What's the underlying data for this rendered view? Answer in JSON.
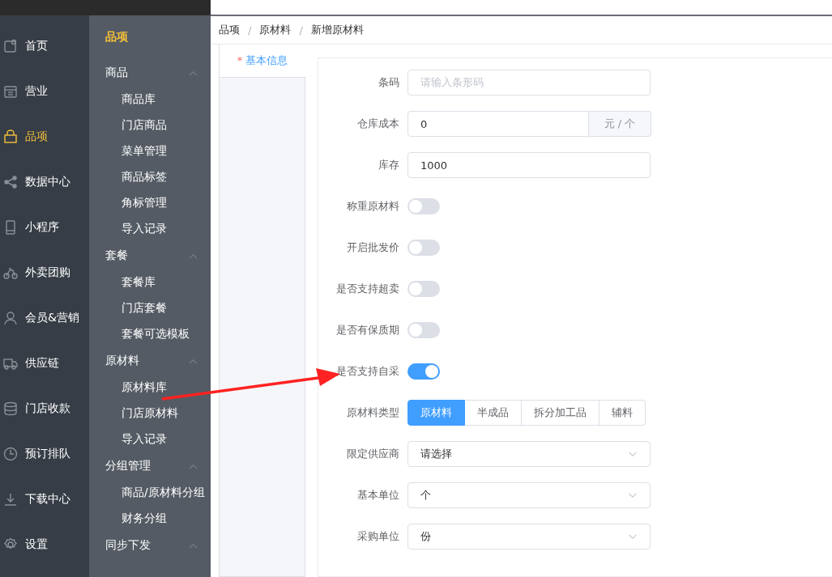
{
  "nav": [
    {
      "label": "首页",
      "selected": false
    },
    {
      "label": "营业",
      "selected": false
    },
    {
      "label": "品项",
      "selected": true
    },
    {
      "label": "数据中心",
      "selected": false
    },
    {
      "label": "小程序",
      "selected": false
    },
    {
      "label": "外卖团购",
      "selected": false
    },
    {
      "label": "会员&营销",
      "selected": false
    },
    {
      "label": "供应链",
      "selected": false
    },
    {
      "label": "门店收款",
      "selected": false
    },
    {
      "label": "预订排队",
      "selected": false
    },
    {
      "label": "下载中心",
      "selected": false
    },
    {
      "label": "设置",
      "selected": false
    }
  ],
  "submenu": {
    "title": "品项",
    "groups": [
      {
        "label": "商品",
        "expanded": true,
        "items": [
          "商品库",
          "门店商品",
          "菜单管理",
          "商品标签",
          "角标管理",
          "导入记录"
        ]
      },
      {
        "label": "套餐",
        "expanded": true,
        "items": [
          "套餐库",
          "门店套餐",
          "套餐可选模板"
        ]
      },
      {
        "label": "原材料",
        "expanded": true,
        "items": [
          "原材料库",
          "门店原材料",
          "导入记录"
        ]
      },
      {
        "label": "分组管理",
        "expanded": true,
        "items": [
          "商品/原材料分组",
          "财务分组"
        ]
      },
      {
        "label": "同步下发",
        "expanded": true
      }
    ]
  },
  "breadcrumb": {
    "separator": "/",
    "items": [
      "品项",
      "原材料",
      "新增原材料"
    ]
  },
  "tabs": [
    {
      "label": "基本信息",
      "required_mark": "*",
      "selected": true
    }
  ],
  "form": [
    {
      "kind": "text",
      "label": "条码",
      "placeholder": "请输入条形码"
    },
    {
      "kind": "addon",
      "label": "仓库成本",
      "value": "0",
      "addon": "元 / 个"
    },
    {
      "kind": "text",
      "label": "库存",
      "value": "1000"
    },
    {
      "kind": "switch",
      "label": "称重原材料",
      "on": false
    },
    {
      "kind": "switch",
      "label": "开启批发价",
      "on": false
    },
    {
      "kind": "switch",
      "label": "是否支持超卖",
      "on": false
    },
    {
      "kind": "switch",
      "label": "是否有保质期",
      "on": false
    },
    {
      "kind": "switch",
      "label": "是否支持自采",
      "on": true
    },
    {
      "kind": "segmented",
      "label": "原材料类型",
      "options": [
        {
          "label": "原材料",
          "selected": true
        },
        {
          "label": "半成品",
          "selected": false
        },
        {
          "label": "拆分加工品",
          "selected": false
        },
        {
          "label": "辅料",
          "selected": false
        }
      ]
    },
    {
      "kind": "select",
      "label": "限定供应商",
      "placeholder": "请选择"
    },
    {
      "kind": "select",
      "label": "基本单位",
      "value": "个"
    },
    {
      "kind": "select",
      "label": "采购单位",
      "value": "份"
    }
  ]
}
